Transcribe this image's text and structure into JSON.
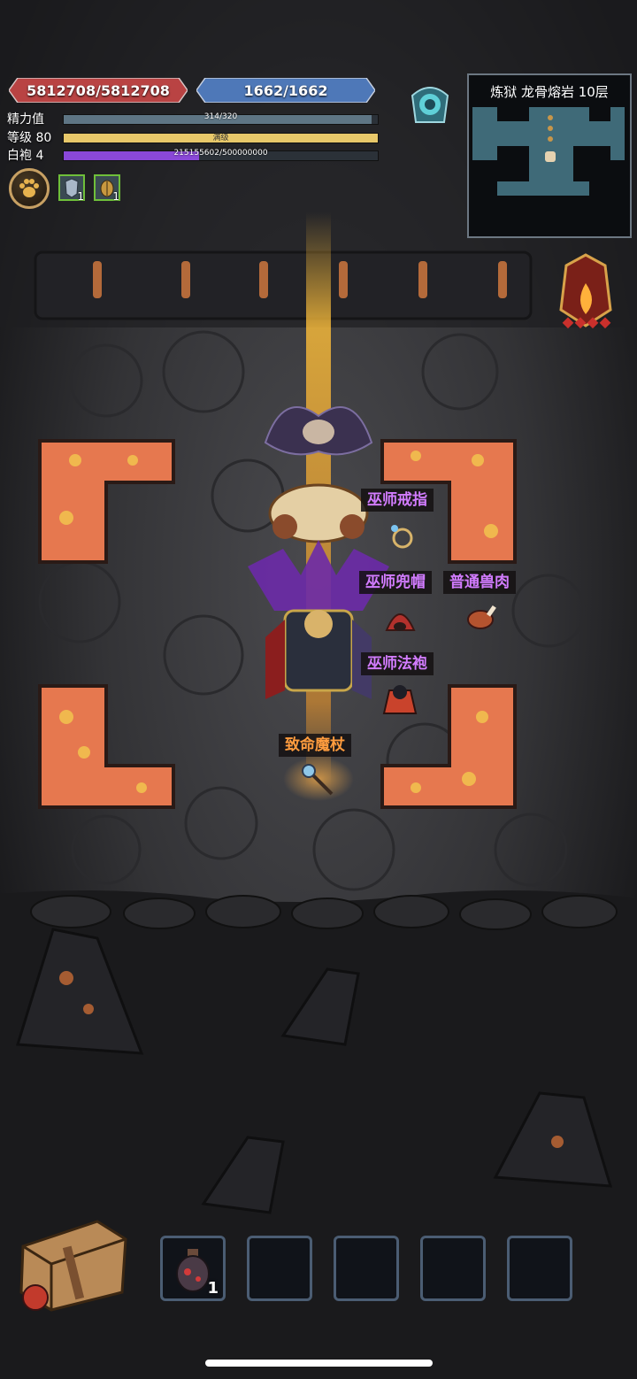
{
  "hud": {
    "hp": "5812708/5812708",
    "mp": "1662/1662",
    "bars": [
      {
        "label": "精力值",
        "text": "314/320",
        "fraction": 0.98,
        "color": "#5e7584"
      },
      {
        "label": "等级 80",
        "text": "满级",
        "fraction": 1.0,
        "color": "#e8c86a"
      },
      {
        "label": "白袍 4",
        "text": "215155602/500000000",
        "fraction": 0.43,
        "color": "#8a48d8"
      }
    ],
    "buffs": [
      {
        "icon": "armor-buff-icon",
        "count": "1"
      },
      {
        "icon": "beetle-buff-icon",
        "count": "1"
      }
    ]
  },
  "minimap": {
    "title": "炼狱 龙骨熔岩 10层"
  },
  "items": {
    "ring": "巫师戒指",
    "hat": "巫师兜帽",
    "meat": "普通兽肉",
    "robe": "巫师法袍",
    "staff": "致命魔杖"
  },
  "quickbar": {
    "slots": [
      {
        "icon": "potion-flask-icon",
        "count": "1"
      },
      {
        "icon": "",
        "count": ""
      },
      {
        "icon": "",
        "count": ""
      },
      {
        "icon": "",
        "count": ""
      },
      {
        "icon": "",
        "count": ""
      }
    ]
  },
  "colors": {
    "lava": "#e6784f",
    "lava_spot": "#f0b84e",
    "floor": "#3a3a3d",
    "hp_banner": "#b94343",
    "mp_banner": "#4e78b8"
  }
}
